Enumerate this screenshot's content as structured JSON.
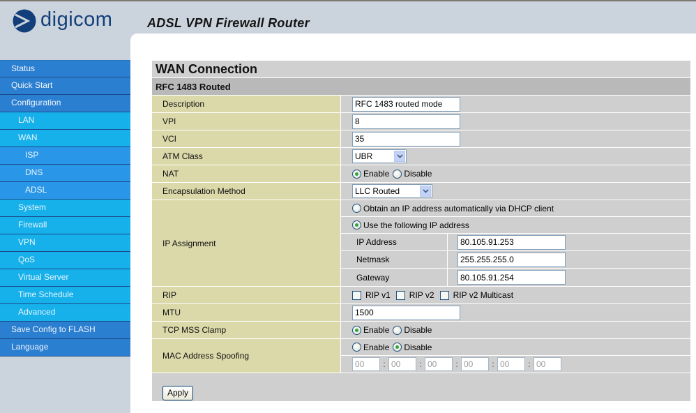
{
  "header": {
    "brand": "digicom",
    "product_title": "ADSL VPN Firewall Router"
  },
  "sidebar": {
    "items": [
      {
        "label": "Status",
        "level": 0
      },
      {
        "label": "Quick Start",
        "level": 0
      },
      {
        "label": "Configuration",
        "level": 0
      },
      {
        "label": "LAN",
        "level": 1
      },
      {
        "label": "WAN",
        "level": 1
      },
      {
        "label": "ISP",
        "level": 2
      },
      {
        "label": "DNS",
        "level": 2
      },
      {
        "label": "ADSL",
        "level": 2
      },
      {
        "label": "System",
        "level": 1
      },
      {
        "label": "Firewall",
        "level": 1
      },
      {
        "label": "VPN",
        "level": 1
      },
      {
        "label": "QoS",
        "level": 1
      },
      {
        "label": "Virtual Server",
        "level": 1
      },
      {
        "label": "Time Schedule",
        "level": 1
      },
      {
        "label": "Advanced",
        "level": 1
      },
      {
        "label": "Save Config to FLASH",
        "level": 0
      },
      {
        "label": "Language",
        "level": 0
      }
    ]
  },
  "main": {
    "title": "WAN Connection",
    "subtitle": "RFC 1483 Routed",
    "description": {
      "label": "Description",
      "value": "RFC 1483 routed mode"
    },
    "vpi": {
      "label": "VPI",
      "value": "8"
    },
    "vci": {
      "label": "VCI",
      "value": "35"
    },
    "atm_class": {
      "label": "ATM Class",
      "selected": "UBR"
    },
    "nat": {
      "label": "NAT",
      "enable": "Enable",
      "disable": "Disable",
      "selected": "Enable"
    },
    "encapsulation": {
      "label": "Encapsulation Method",
      "selected": "LLC Routed"
    },
    "ip_assignment": {
      "label": "IP Assignment",
      "option_dhcp": "Obtain an IP address automatically via DHCP client",
      "option_static": "Use the following IP address",
      "selected": "static",
      "ip_address": {
        "label": "IP Address",
        "value": "80.105.91.253"
      },
      "netmask": {
        "label": "Netmask",
        "value": "255.255.255.0"
      },
      "gateway": {
        "label": "Gateway",
        "value": "80.105.91.254"
      }
    },
    "rip": {
      "label": "RIP",
      "options": [
        {
          "label": "RIP v1",
          "checked": false
        },
        {
          "label": "RIP v2",
          "checked": false
        },
        {
          "label": "RIP v2 Multicast",
          "checked": false
        }
      ]
    },
    "mtu": {
      "label": "MTU",
      "value": "1500"
    },
    "tcp_mss_clamp": {
      "label": "TCP MSS Clamp",
      "enable": "Enable",
      "disable": "Disable",
      "selected": "Enable"
    },
    "mac_spoofing": {
      "label": "MAC Address Spoofing",
      "enable": "Enable",
      "disable": "Disable",
      "selected": "Disable",
      "octets": [
        "00",
        "00",
        "00",
        "00",
        "00",
        "00"
      ],
      "separator": ":"
    },
    "apply_label": "Apply"
  }
}
